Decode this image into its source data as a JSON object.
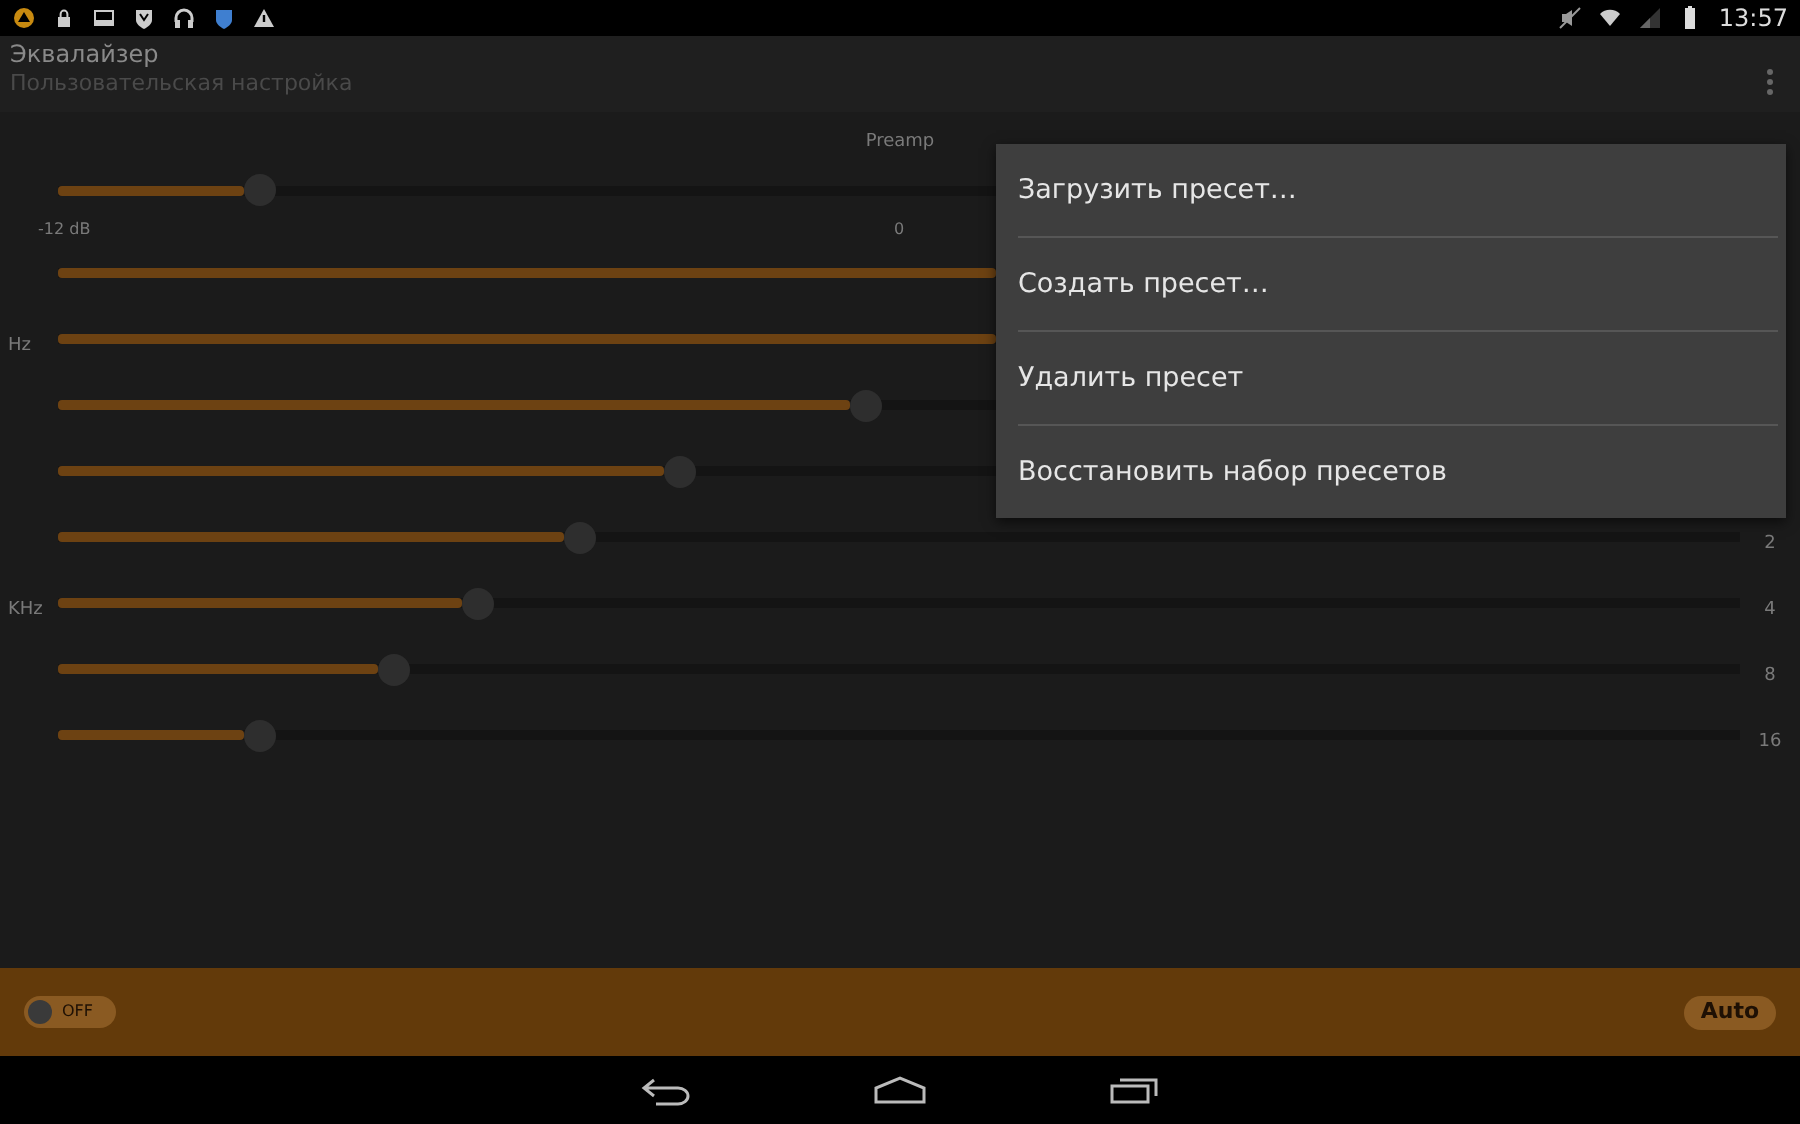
{
  "status_bar": {
    "time": "13:57"
  },
  "app_bar": {
    "title": "Эквалайзер",
    "subtitle": "Пользовательская настройка"
  },
  "preamp": {
    "label": "Preamp",
    "level": 0.12,
    "min_label": "-12 dB",
    "mid_label": "0"
  },
  "bands": [
    {
      "kind": "covered"
    },
    {
      "kind": "covered",
      "unit_label": "Hz"
    },
    {
      "kind": "slider",
      "level": 0.48
    },
    {
      "kind": "slider",
      "level": 0.37
    },
    {
      "kind": "slider",
      "level": 0.31,
      "value_label": "2"
    },
    {
      "kind": "slider",
      "level": 0.25,
      "unit_label": "KHz",
      "value_label": "4"
    },
    {
      "kind": "slider",
      "level": 0.2,
      "value_label": "8"
    },
    {
      "kind": "slider",
      "level": 0.12,
      "value_label": "16"
    }
  ],
  "bottom_bar": {
    "toggle": {
      "label": "OFF",
      "on": false
    },
    "auto_button": "Auto"
  },
  "menu": {
    "items": [
      "Загрузить пресет…",
      "Создать пресет…",
      "Удалить пресет",
      "Восстановить набор пресетов"
    ]
  }
}
